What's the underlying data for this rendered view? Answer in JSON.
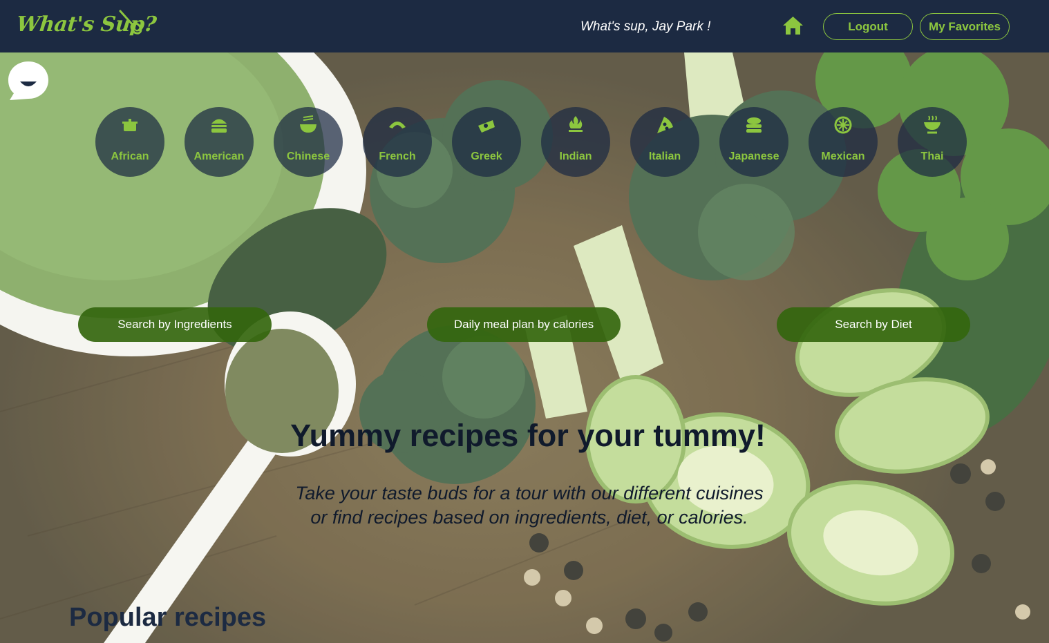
{
  "header": {
    "logo": "What's Sup?",
    "greeting": "What's sup, Jay Park !",
    "logout_label": "Logout",
    "favorites_label": "My Favorites"
  },
  "cuisines": [
    {
      "label": "African",
      "icon": "pot-icon"
    },
    {
      "label": "American",
      "icon": "burger-icon"
    },
    {
      "label": "Chinese",
      "icon": "noodle-bowl-icon"
    },
    {
      "label": "French",
      "icon": "croissant-icon"
    },
    {
      "label": "Greek",
      "icon": "greek-dish-icon"
    },
    {
      "label": "Indian",
      "icon": "fire-pot-icon"
    },
    {
      "label": "Italian",
      "icon": "pizza-icon"
    },
    {
      "label": "Japanese",
      "icon": "sushi-icon"
    },
    {
      "label": "Mexican",
      "icon": "lime-icon"
    },
    {
      "label": "Thai",
      "icon": "wok-icon"
    }
  ],
  "search": {
    "ingredients_label": "Search by Ingredients",
    "calories_label": "Daily meal plan by calories",
    "diet_label": "Search by Diet"
  },
  "hero": {
    "headline": "Yummy recipes for your tummy!",
    "subline1": "Take your taste buds for a tour with our different cuisines",
    "subline2": "or find recipes based on ingredients, diet, or calories."
  },
  "popular_title": "Popular recipes",
  "colors": {
    "header_bg": "#1c2a42",
    "accent_green": "#8cc63f",
    "button_green": "#34660e"
  }
}
